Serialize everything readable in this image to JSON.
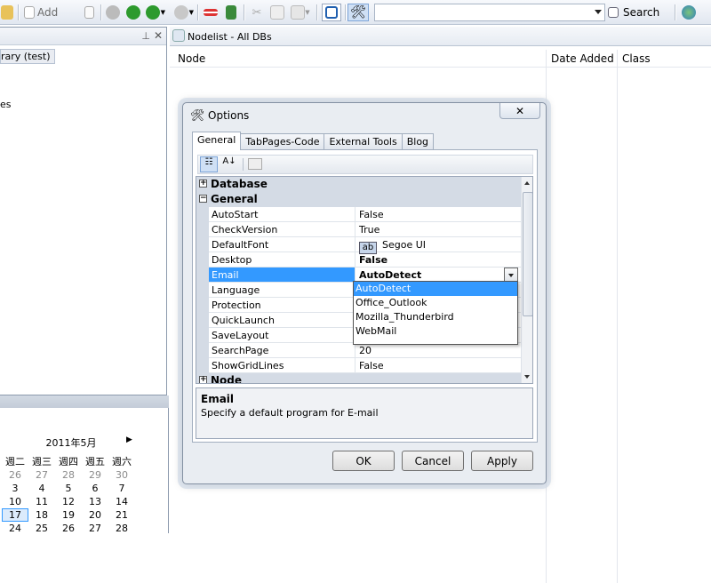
{
  "toolbar": {
    "add_label": "Add",
    "search_label": "Search",
    "search_placeholder": ""
  },
  "left_panel": {
    "library_item": "rary (test)",
    "partial_item": "es"
  },
  "calendar": {
    "title": "2011年5月",
    "weekdays": [
      "週二",
      "週三",
      "週四",
      "週五",
      "週六"
    ],
    "weeks": [
      [
        "26",
        "27",
        "28",
        "29",
        "30"
      ],
      [
        "3",
        "4",
        "5",
        "6",
        "7"
      ],
      [
        "10",
        "11",
        "12",
        "13",
        "14"
      ],
      [
        "17",
        "18",
        "19",
        "20",
        "21"
      ],
      [
        "24",
        "25",
        "26",
        "27",
        "28"
      ]
    ],
    "selected_day": "17"
  },
  "document": {
    "tab_title": "Nodelist - All DBs",
    "columns": [
      "Node",
      "Date Added",
      "Class"
    ]
  },
  "dialog": {
    "title": "Options",
    "tabs": [
      "General",
      "TabPages-Code",
      "External Tools",
      "Blog"
    ],
    "active_tab": "General",
    "categories": {
      "database": "Database",
      "general": "General",
      "node": "Node"
    },
    "properties": [
      {
        "name": "AutoStart",
        "value": "False"
      },
      {
        "name": "CheckVersion",
        "value": "True"
      },
      {
        "name": "DefaultFont",
        "value": "Segoe UI"
      },
      {
        "name": "Desktop",
        "value": "False"
      },
      {
        "name": "Email",
        "value": "AutoDetect"
      },
      {
        "name": "Language",
        "value": ""
      },
      {
        "name": "Protection",
        "value": ""
      },
      {
        "name": "QuickLaunch",
        "value": ""
      },
      {
        "name": "SaveLayout",
        "value": ""
      },
      {
        "name": "SearchPage",
        "value": "20"
      },
      {
        "name": "ShowGridLines",
        "value": "False"
      }
    ],
    "font_icon_text": "ab",
    "dropdown_options": [
      "AutoDetect",
      "Office_Outlook",
      "Mozilla_Thunderbird",
      "WebMail"
    ],
    "help": {
      "title": "Email",
      "description": "Specify a default program for E-mail"
    },
    "buttons": {
      "ok": "OK",
      "cancel": "Cancel",
      "apply": "Apply"
    }
  }
}
